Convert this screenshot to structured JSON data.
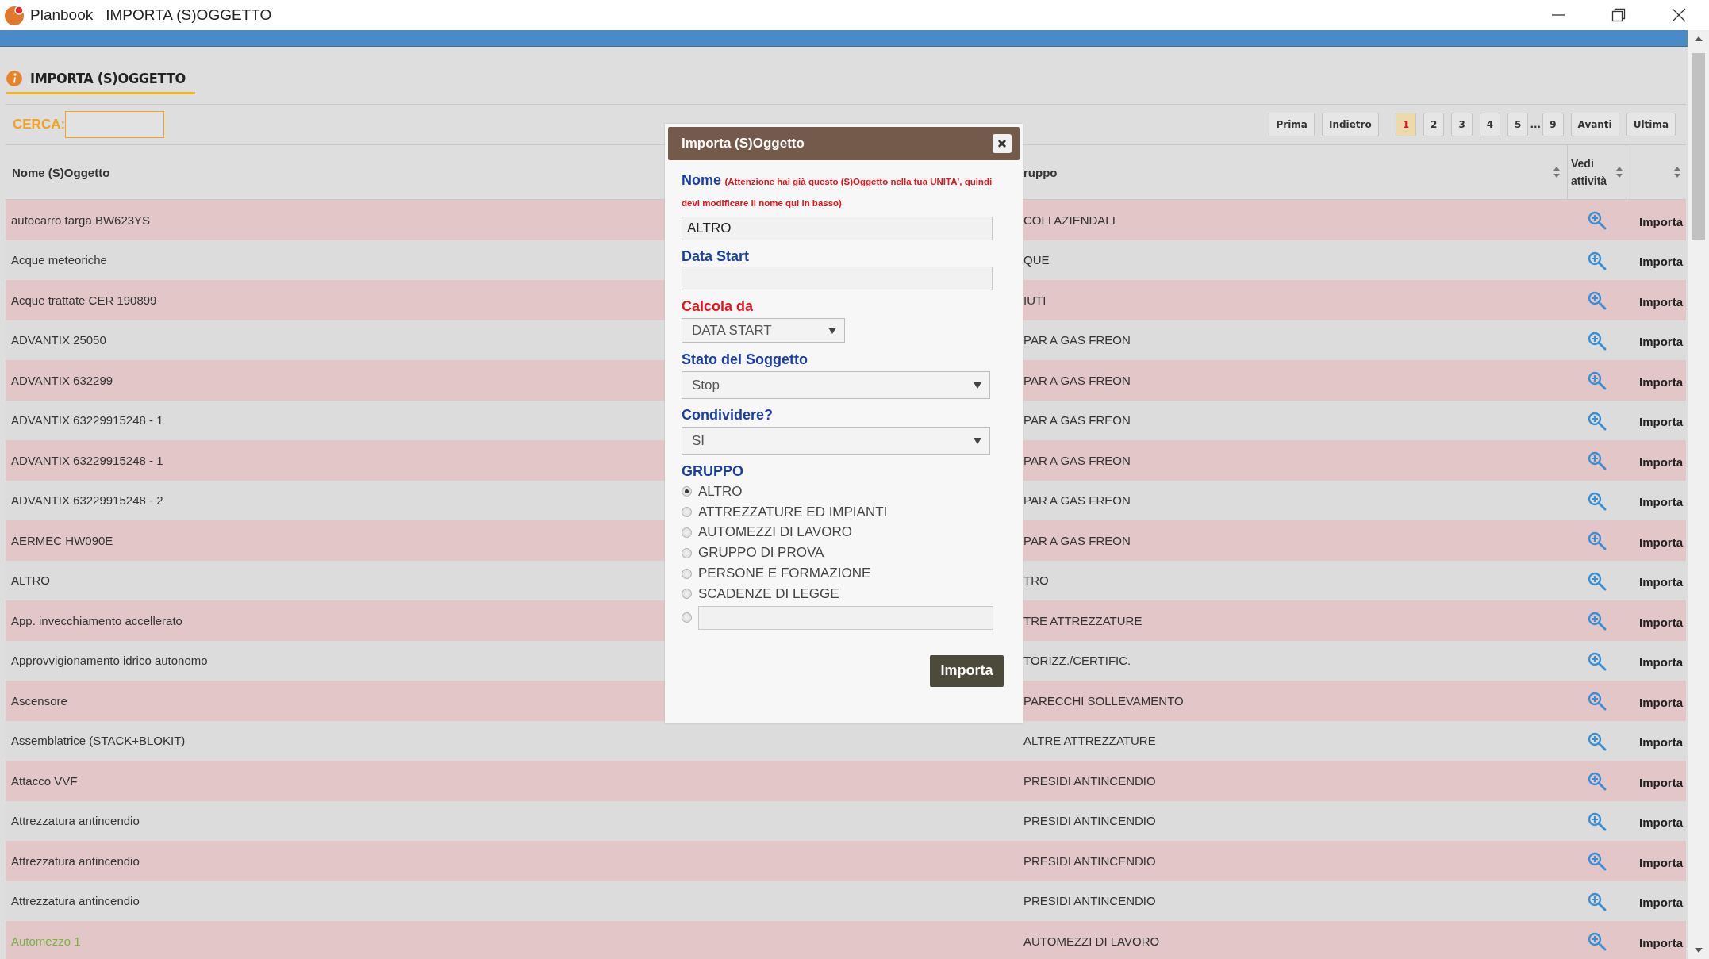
{
  "window": {
    "app": "Planbook",
    "title": "IMPORTA (S)OGGETTO"
  },
  "page": {
    "title": "IMPORTA (S)OGGETTO"
  },
  "search": {
    "label": "CERCA:"
  },
  "pagination": [
    {
      "label": "Prima",
      "kind": "nav"
    },
    {
      "label": "Indietro",
      "kind": "nav"
    },
    {
      "label": "1",
      "kind": "page",
      "selected": true
    },
    {
      "label": "2",
      "kind": "page",
      "selected": false
    },
    {
      "label": "3",
      "kind": "page",
      "selected": false
    },
    {
      "label": "4",
      "kind": "page",
      "selected": false
    },
    {
      "label": "5",
      "kind": "page",
      "selected": false
    },
    {
      "label": "...",
      "kind": "gap"
    },
    {
      "label": "9",
      "kind": "page",
      "selected": false
    },
    {
      "label": "Avanti",
      "kind": "nav"
    },
    {
      "label": "Ultima",
      "kind": "nav"
    }
  ],
  "table": {
    "columns": [
      {
        "label": "Nome (S)Oggetto"
      },
      {
        "label": "ruppo"
      },
      {
        "label": "Vedi attività"
      }
    ],
    "rows": [
      {
        "name": "autocarro targa BW623YS",
        "group": "COLI AZIENDALI",
        "action": "Importa",
        "active": false
      },
      {
        "name": "Acque meteoriche",
        "group": "QUE",
        "action": "Importa",
        "active": false
      },
      {
        "name": "Acque trattate CER 190899",
        "group": "IUTI",
        "action": "Importa",
        "active": false
      },
      {
        "name": "ADVANTIX 25050",
        "group": "PAR A GAS FREON",
        "action": "Importa",
        "active": false
      },
      {
        "name": "ADVANTIX 632299",
        "group": "PAR A GAS FREON",
        "action": "Importa",
        "active": false
      },
      {
        "name": "ADVANTIX 63229915248 - 1",
        "group": "PAR A GAS FREON",
        "action": "Importa",
        "active": false
      },
      {
        "name": "ADVANTIX 63229915248 - 1",
        "group": "PAR A GAS FREON",
        "action": "Importa",
        "active": false
      },
      {
        "name": "ADVANTIX 63229915248 - 2",
        "group": "PAR A GAS FREON",
        "action": "Importa",
        "active": false
      },
      {
        "name": "AERMEC HW090E",
        "group": "PAR A GAS FREON",
        "action": "Importa",
        "active": false
      },
      {
        "name": "ALTRO",
        "group": "TRO",
        "action": "Importa",
        "active": false
      },
      {
        "name": "App. invecchiamento accellerato",
        "group": "TRE ATTREZZATURE",
        "action": "Importa",
        "active": false
      },
      {
        "name": "Approvvigionamento idrico autonomo",
        "group": "TORIZZ./CERTIFIC.",
        "action": "Importa",
        "active": false
      },
      {
        "name": "Ascensore",
        "group": "PARECCHI SOLLEVAMENTO",
        "action": "Importa",
        "active": false
      },
      {
        "name": "Assemblatrice (STACK+BLOKIT)",
        "group": "ALTRE ATTREZZATURE",
        "action": "Importa",
        "active": false
      },
      {
        "name": "Attacco VVF",
        "group": "PRESIDI ANTINCENDIO",
        "action": "Importa",
        "active": false
      },
      {
        "name": "Attrezzatura antincendio",
        "group": "PRESIDI ANTINCENDIO",
        "action": "Importa",
        "active": false
      },
      {
        "name": "Attrezzatura antincendio",
        "group": "PRESIDI ANTINCENDIO",
        "action": "Importa",
        "active": false
      },
      {
        "name": "Attrezzatura antincendio",
        "group": "PRESIDI ANTINCENDIO",
        "action": "Importa",
        "active": false
      },
      {
        "name": "Automezzo 1",
        "group": "AUTOMEZZI DI LAVORO",
        "action": "Importa",
        "active": true
      }
    ]
  },
  "dialog": {
    "title": "Importa (S)Oggetto",
    "name_label": "Nome",
    "warning": "(Attenzione hai già questo (S)Oggetto nella tua UNITA', quindi devi modificare il nome qui in basso)",
    "name_value": "ALTRO",
    "start_label": "Data Start",
    "calc_label": "Calcola da",
    "calc_value": "DATA START",
    "state_label": "Stato del Soggetto",
    "state_value": "Stop",
    "share_label": "Condividere?",
    "share_value": "SI",
    "group_label": "GRUPPO",
    "groups": [
      {
        "label": "ALTRO",
        "kind": "option",
        "selected": true
      },
      {
        "label": "ATTREZZATURE ED IMPIANTI",
        "kind": "option",
        "selected": false
      },
      {
        "label": "AUTOMEZZI DI LAVORO",
        "kind": "option",
        "selected": false
      },
      {
        "label": "GRUPPO DI PROVA",
        "kind": "option",
        "selected": false
      },
      {
        "label": "PERSONE E FORMAZIONE",
        "kind": "option",
        "selected": false
      },
      {
        "label": "SCADENZE DI LEGGE",
        "kind": "option",
        "selected": false
      },
      {
        "kind": "input",
        "selected": false
      }
    ],
    "submit": "Importa"
  }
}
